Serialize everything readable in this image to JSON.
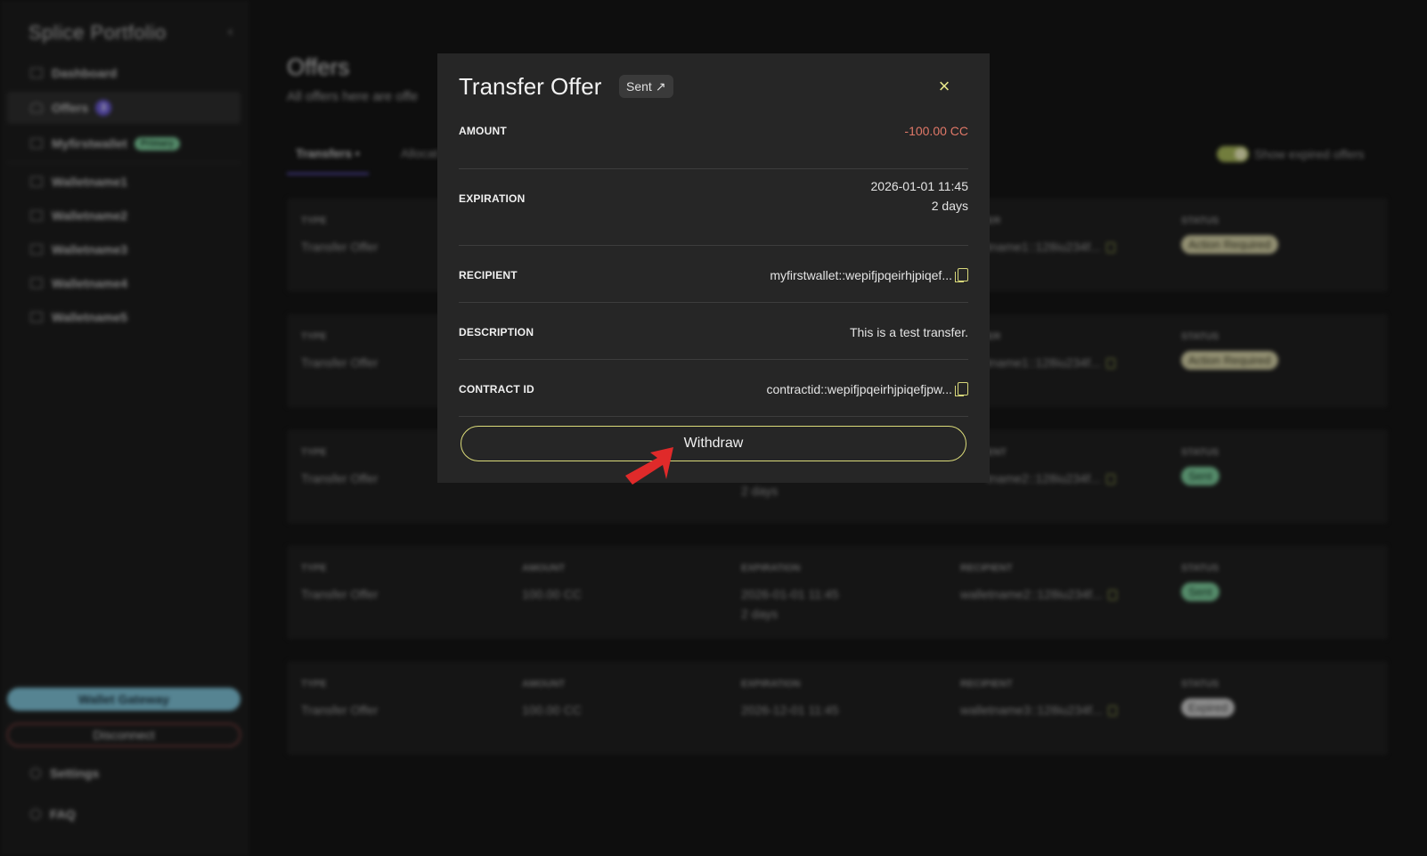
{
  "sidebar": {
    "brand": "Splice Portfolio",
    "collapse_glyph": "‹",
    "items": [
      {
        "label": "Dashboard"
      },
      {
        "label": "Offers",
        "count": "3"
      },
      {
        "label": "Myfirstwallet",
        "badge": "Primary"
      },
      {
        "label": "Walletname1"
      },
      {
        "label": "Walletname2"
      },
      {
        "label": "Walletname3"
      },
      {
        "label": "Walletname4"
      },
      {
        "label": "Walletname5"
      }
    ],
    "gateway": "Wallet Gateway",
    "disconnect": "Disconnect",
    "settings": "Settings",
    "faq": "FAQ"
  },
  "page": {
    "title": "Offers",
    "subtitle": "All offers here are offe",
    "tabs": [
      "Transfers •",
      "Allocat"
    ],
    "toggle_label": "Show expired offers",
    "rows": [
      {
        "type_label": "TYPE",
        "type": "Transfer Offer",
        "party_label": "ER",
        "party": "tname1::128iu234f...",
        "status_label": "STATUS",
        "status": "Action Required"
      },
      {
        "type_label": "TYPE",
        "type": "Transfer Offer",
        "party_label": "ER",
        "party": "tname1::128iu234f...",
        "status_label": "STATUS",
        "status": "Action Required"
      },
      {
        "type_label": "TYPE",
        "type": "Transfer Offer",
        "exp_tail": "2 days",
        "party_label": "ENT",
        "party": "tname2::128iu234f...",
        "status_label": "STATUS",
        "status": "Sent"
      },
      {
        "type_label": "TYPE",
        "type": "Transfer Offer",
        "amount_label": "AMOUNT",
        "amount": "100.00 CC",
        "exp_label": "EXPIRATION",
        "exp": "2026-01-01 11:45",
        "exp_tail": "2 days",
        "party_label": "RECIPIENT",
        "party": "walletname2::128iu234f...",
        "status_label": "STATUS",
        "status": "Sent"
      },
      {
        "type_label": "TYPE",
        "type": "Transfer Offer",
        "amount_label": "AMOUNT",
        "amount": "100.00 CC",
        "exp_label": "EXPIRATION",
        "exp": "2026-12-01 11:45",
        "party_label": "RECIPIENT",
        "party": "walletname3::128iu234f...",
        "status_label": "STATUS",
        "status": "Expired"
      }
    ]
  },
  "modal": {
    "title": "Transfer Offer",
    "badge": "Sent",
    "badge_arrow": "↗",
    "close_glyph": "×",
    "amount_label": "AMOUNT",
    "amount": "-100.00 CC",
    "expiration_label": "EXPIRATION",
    "expiration_date": "2026-01-01 11:45",
    "expiration_rel": "2 days",
    "recipient_label": "RECIPIENT",
    "recipient": "myfirstwallet::wepifjpqeirhjpiqef...",
    "description_label": "DESCRIPTION",
    "description": "This is a test transfer.",
    "contract_label": "CONTRACT ID",
    "contract": "contractid::wepifjpqeirhjpiqefjpw...",
    "withdraw": "Withdraw"
  },
  "colors": {
    "accent": "#dcdc7a",
    "negative": "#e07868",
    "primary_purple": "#6b5bd6",
    "cursor": "#e02a2a"
  }
}
